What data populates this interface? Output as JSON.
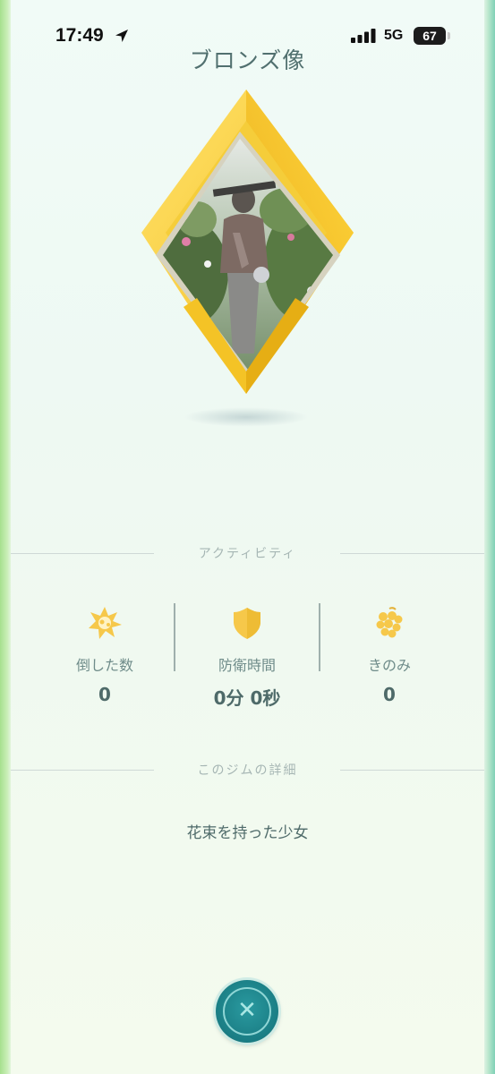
{
  "status_bar": {
    "time": "17:49",
    "network": "5G",
    "battery": "67"
  },
  "gym": {
    "name": "ブロンズ像",
    "photo_alt": "ブロンズ像",
    "badge_colors": {
      "gold": "#f4c326",
      "gold_light": "#ffe36a",
      "frame": "#d9d3b8"
    }
  },
  "activity": {
    "section_label": "アクティビティ",
    "stats": [
      {
        "icon": "burst-icon",
        "label": "倒した数",
        "value": "0"
      },
      {
        "icon": "shield-icon",
        "label": "防衛時間",
        "value": "0分 0秒"
      },
      {
        "icon": "berry-icon",
        "label": "きのみ",
        "value": "0"
      }
    ]
  },
  "details": {
    "section_label": "このジムの詳細",
    "description": "花束を持った少女"
  },
  "close_button": {
    "icon": "close-icon",
    "glyph": "✕"
  },
  "colors": {
    "accent_teal": "#1a7d84",
    "icon_gold": "#f6c84a",
    "text": "#4e6a69"
  }
}
